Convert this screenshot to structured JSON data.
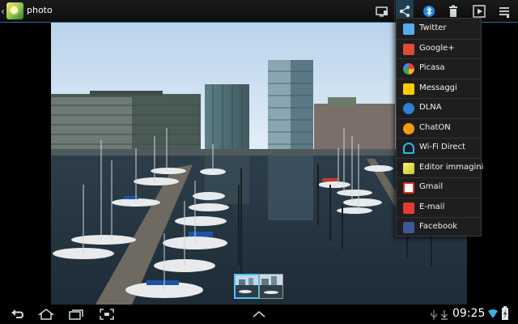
{
  "action_bar": {
    "title": "photo",
    "icons": [
      "back-caret-icon",
      "photo-app-icon",
      "screen-mirror-icon",
      "share-icon",
      "bluetooth-icon",
      "delete-icon",
      "slideshow-play-icon",
      "menu-icon"
    ]
  },
  "share_menu": {
    "items": [
      {
        "label": "Twitter",
        "icon": "twitter-icon",
        "color": "#55acee"
      },
      {
        "label": "Google+",
        "icon": "google-plus-icon",
        "color": "#dd4b39"
      },
      {
        "label": "Picasa",
        "icon": "picasa-icon",
        "color": "#e94235"
      },
      {
        "label": "Messaggi",
        "icon": "messages-icon",
        "color": "#ffcc00"
      },
      {
        "label": "DLNA",
        "icon": "dlna-icon",
        "color": "#2f7fd6"
      },
      {
        "label": "ChatON",
        "icon": "chaton-icon",
        "color": "#f39c12"
      },
      {
        "label": "Wi-Fi Direct",
        "icon": "wifi-direct-icon",
        "color": "#29b6f6"
      },
      {
        "label": "Editor immagini",
        "icon": "image-editor-icon",
        "color": "#c0ca33"
      },
      {
        "label": "Gmail",
        "icon": "gmail-icon",
        "color": "#d93025"
      },
      {
        "label": "E-mail",
        "icon": "email-icon",
        "color": "#e53935"
      },
      {
        "label": "Facebook",
        "icon": "facebook-icon",
        "color": "#3b5998"
      }
    ]
  },
  "nav_bar": {
    "buttons": [
      "back-icon",
      "home-icon",
      "recent-apps-icon",
      "screenshot-icon",
      "up-chevron-icon"
    ],
    "status_icons": [
      "usb-icon",
      "download-icon",
      "wifi-icon",
      "battery-icon"
    ],
    "time": "09:25"
  },
  "accent_color": "#33b5e5"
}
